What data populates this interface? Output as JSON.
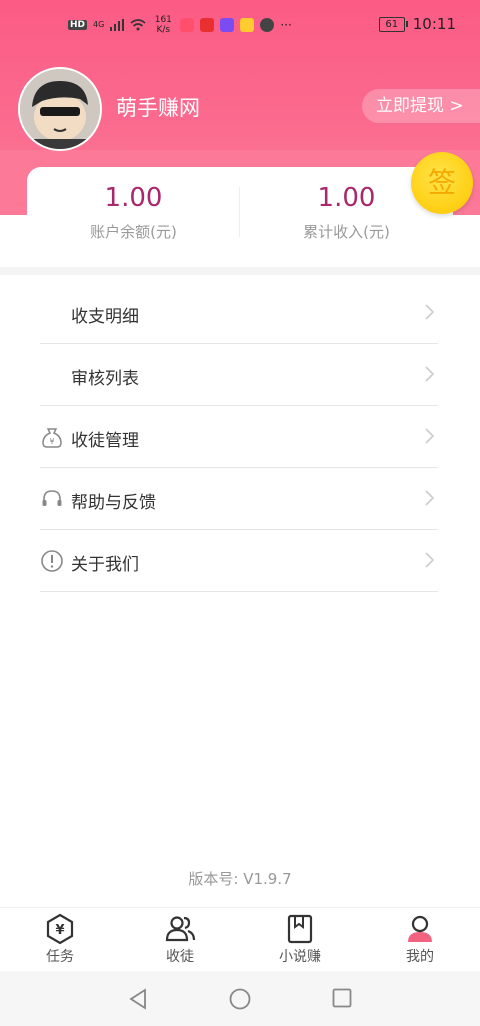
{
  "status_bar": {
    "network": "HD",
    "signal": "4G",
    "speed": "161 K/s",
    "battery": "61",
    "time": "10:11",
    "more": "···"
  },
  "profile": {
    "app_name": "萌手赚网",
    "withdraw_label": "立即提现 >"
  },
  "stats": [
    {
      "value": "1.00",
      "label": "账户余额(元)"
    },
    {
      "value": "1.00",
      "label": "累计收入(元)"
    }
  ],
  "sign_label": "签",
  "menu": [
    {
      "label": "收支明细",
      "icon": "none"
    },
    {
      "label": "审核列表",
      "icon": "none"
    },
    {
      "label": "收徒管理",
      "icon": "money-bag-icon"
    },
    {
      "label": "帮助与反馈",
      "icon": "headset-icon"
    },
    {
      "label": "关于我们",
      "icon": "info-icon"
    }
  ],
  "version": "版本号: V1.9.7",
  "tabs": [
    {
      "label": "任务",
      "icon": "yuan-hexagon-icon"
    },
    {
      "label": "收徒",
      "icon": "people-icon"
    },
    {
      "label": "小说赚",
      "icon": "book-icon"
    },
    {
      "label": "我的",
      "icon": "user-icon",
      "active": true
    }
  ],
  "colors": {
    "header_gradient_top": "#fb5b85",
    "accent_value": "#a8286a",
    "sign_gold": "#ffd21a"
  }
}
